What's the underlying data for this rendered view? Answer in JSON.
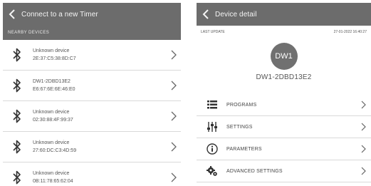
{
  "left_screen": {
    "title": "Connect to a new Timer",
    "section_label": "NEARBY DEVICES",
    "devices": [
      {
        "name": "Unknown device",
        "address": "2E:37:C5:38:8D:C7"
      },
      {
        "name": "DW1-2DBD13E2",
        "address": "E6:67:6E:6E:46:E0"
      },
      {
        "name": "Unknown device",
        "address": "02:30:88:4F:99:37"
      },
      {
        "name": "Unknown device",
        "address": "27:60:DC:C3:4D:59"
      },
      {
        "name": "Unknown device",
        "address": "0B:11:78:65:62:04"
      }
    ]
  },
  "right_screen": {
    "title": "Device detail",
    "last_update_label": "LAST UPDATE",
    "last_update_value": "27-01-2022 16:40:27",
    "avatar_text": "DW1",
    "device_id": "DW1-2DBD13E2",
    "menu": [
      {
        "label": "PROGRAMS",
        "icon": "list-icon"
      },
      {
        "label": "SETTINGS",
        "icon": "sliders-icon"
      },
      {
        "label": "PARAMETERS",
        "icon": "info-icon"
      },
      {
        "label": "ADVANCED SETTINGS",
        "icon": "gears-icon"
      }
    ]
  },
  "colors": {
    "header": "#6c6c6c",
    "avatar": "#707070",
    "divider": "#d9d9d9"
  }
}
